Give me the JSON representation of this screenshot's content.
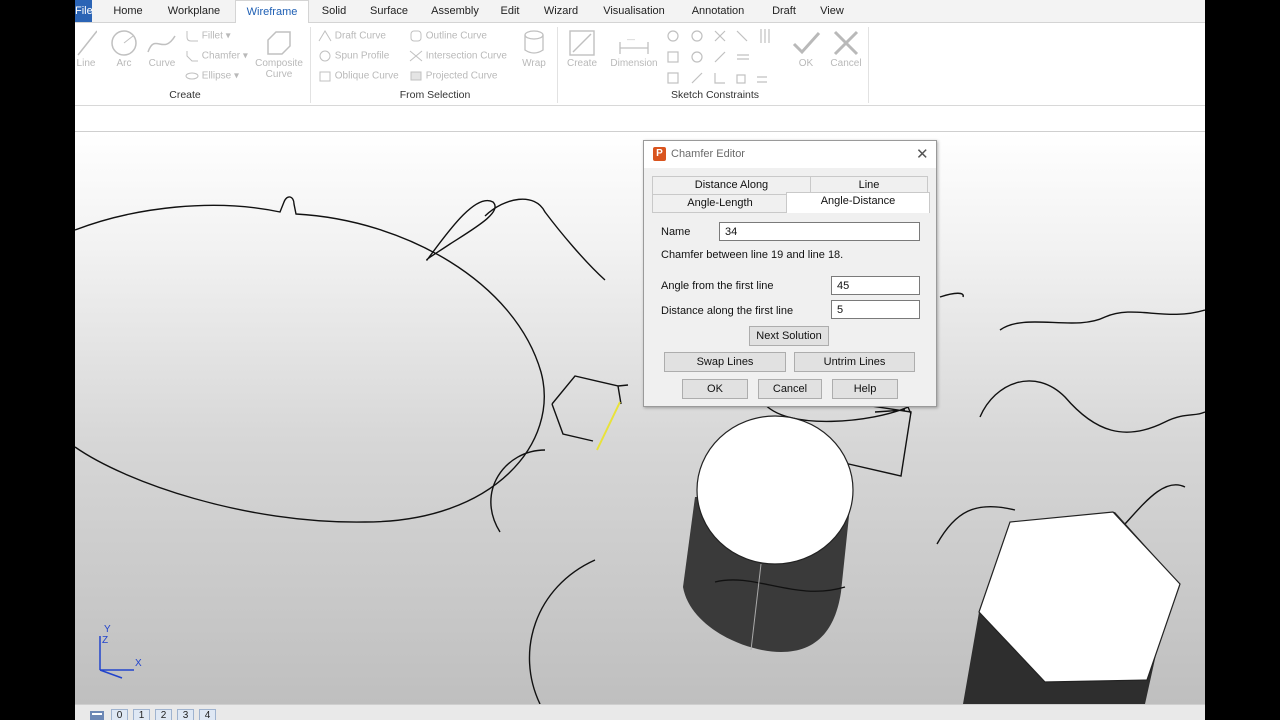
{
  "tabs": [
    "File",
    "Home",
    "Workplane",
    "Wireframe",
    "Solid",
    "Surface",
    "Assembly",
    "Edit",
    "Wizard",
    "Visualisation",
    "Annotation",
    "Draft",
    "View"
  ],
  "active_tab": "Wireframe",
  "ribbon": {
    "create": {
      "line": "Line",
      "arc": "Arc",
      "curve": "Curve",
      "fillet": "Fillet",
      "chamfer": "Chamfer",
      "ellipse": "Ellipse",
      "composite1": "Composite",
      "composite2": "Curve",
      "group": "Create"
    },
    "from_selection": {
      "draft_curve": "Draft Curve",
      "spun_profile": "Spun Profile",
      "oblique_curve": "Oblique Curve",
      "outline_curve": "Outline Curve",
      "intersection_curve": "Intersection Curve",
      "projected_curve": "Projected Curve",
      "wrap": "Wrap",
      "group": "From Selection"
    },
    "constraints": {
      "create": "Create",
      "dimension": "Dimension",
      "ok": "OK",
      "cancel": "Cancel",
      "group": "Sketch Constraints"
    }
  },
  "dialog": {
    "title": "Chamfer Editor",
    "tabs": [
      "Distance Along",
      "Line",
      "Angle-Length",
      "Angle-Distance"
    ],
    "selected_tab": "Angle-Distance",
    "name_label": "Name",
    "name_value": "34",
    "info": "Chamfer between line 19 and line 18.",
    "angle_label": "Angle from the first line",
    "angle_value": "45",
    "distance_label": "Distance along the first line",
    "distance_value": "5",
    "next_solution": "Next Solution",
    "swap_lines": "Swap Lines",
    "untrim_lines": "Untrim Lines",
    "ok": "OK",
    "cancel": "Cancel",
    "help": "Help"
  },
  "axes": {
    "y": "Y",
    "z": "Z",
    "x": "X"
  },
  "levels": [
    "0",
    "1",
    "2",
    "3",
    "4"
  ],
  "colors": {
    "file_tab": "#2b64b5",
    "selected_edge": "#e8e23a",
    "logo": "#d9541e"
  }
}
